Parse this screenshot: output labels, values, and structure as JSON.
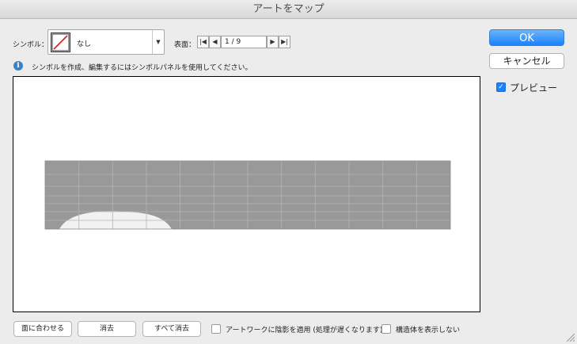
{
  "window": {
    "title": "アートをマップ"
  },
  "symbol": {
    "label": "シンボル：",
    "value": "なし"
  },
  "surface": {
    "label": "表面：",
    "page": "1 / 9"
  },
  "info_text": "シンボルを作成、編集するにはシンボルパネルを使用してください。",
  "buttons": {
    "ok": "OK",
    "cancel": "キャンセル",
    "fit": "面に合わせる",
    "clear": "消去",
    "clear_all": "すべて消去"
  },
  "preview_checkbox": {
    "label": "プレビュー",
    "checked": true
  },
  "shading_checkbox": {
    "label": "アートワークに陰影を適用 (処理が遅くなります)",
    "checked": false
  },
  "hidden_geometry_checkbox": {
    "label": "構造体を表示しない",
    "checked": false
  },
  "colors": {
    "accent": "#1a82fb",
    "mesh_fill": "#999999",
    "mesh_line": "#b5b5b5",
    "art_fill": "#f2f2f2"
  }
}
